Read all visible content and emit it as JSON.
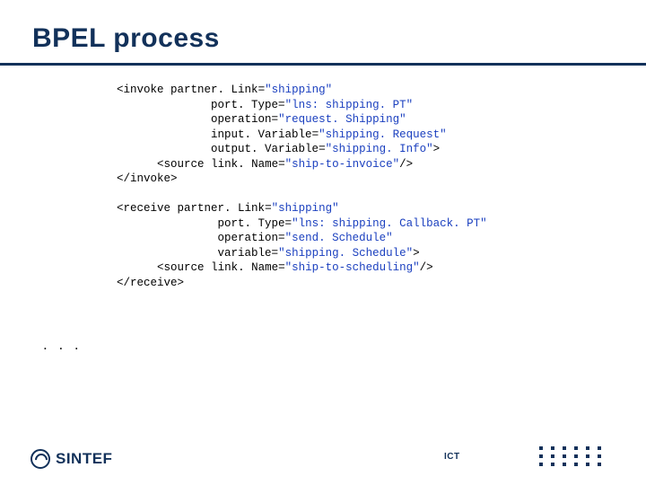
{
  "title": "BPEL process",
  "ellipsis": ". . .",
  "footer": {
    "logo_text": "SINTEF",
    "label": "ICT"
  },
  "code": {
    "invoke": {
      "open_lt": "<",
      "open_tag": "invoke",
      "partnerLink_key": "partner. Link",
      "partnerLink_val": "\"shipping\"",
      "portType_key": "port. Type",
      "portType_val": "\"lns: shipping. PT\"",
      "operation_key": "operation",
      "operation_val": "\"request. Shipping\"",
      "inputVar_key": "input. Variable",
      "inputVar_val": "\"shipping. Request\"",
      "outputVar_key": "output. Variable",
      "outputVar_val": "\"shipping. Info\"",
      "gt": ">",
      "source_lt": "<",
      "source_tag": "source",
      "linkName_key": "link. Name",
      "linkName_val": "\"ship-to-invoice\"",
      "source_close": "/>",
      "close": "</invoke>"
    },
    "receive": {
      "open_lt": "<",
      "open_tag": "receive",
      "partnerLink_key": "partner. Link",
      "partnerLink_val": "\"shipping\"",
      "portType_key": "port. Type",
      "portType_val": "\"lns: shipping. Callback. PT\"",
      "operation_key": "operation",
      "operation_val": "\"send. Schedule\"",
      "variable_key": "variable",
      "variable_val": "\"shipping. Schedule\"",
      "gt": ">",
      "source_lt": "<",
      "source_tag": "source",
      "linkName_key": "link. Name",
      "linkName_val": "\"ship-to-scheduling\"",
      "source_close": "/>",
      "close": "</receive>"
    },
    "eq": "="
  }
}
